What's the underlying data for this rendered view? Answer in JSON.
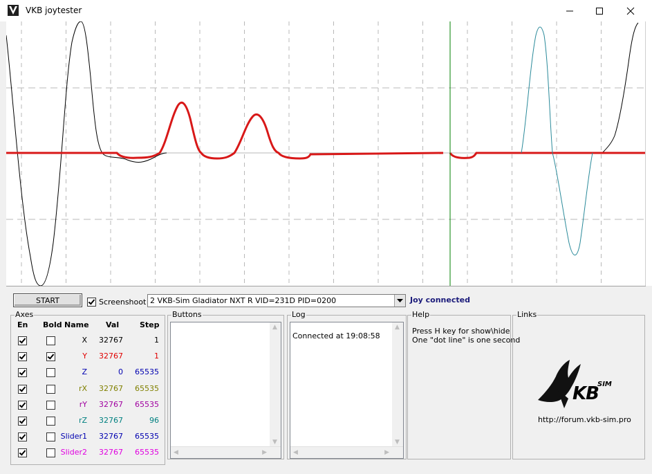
{
  "window": {
    "title": "VKB joytester"
  },
  "toolbar": {
    "start_label": "START",
    "screenshot_label": "Screenshoot",
    "screenshot_checked": true,
    "device_selected": "2  VKB-Sim Gladiator NXT R   VID=231D PID=0200",
    "status": "Joy connected"
  },
  "axes": {
    "group_title": "Axes",
    "headers": {
      "en": "En",
      "bold": "Bold",
      "name": "Name",
      "val": "Val",
      "step": "Step"
    },
    "rows": [
      {
        "name": "X",
        "val": "32767",
        "step": "1",
        "en": true,
        "bold": false,
        "color": "#000000"
      },
      {
        "name": "Y",
        "val": "32767",
        "step": "1",
        "en": true,
        "bold": true,
        "color": "#e00000"
      },
      {
        "name": "Z",
        "val": "0",
        "step": "65535",
        "en": true,
        "bold": false,
        "color": "#0000b0"
      },
      {
        "name": "rX",
        "val": "32767",
        "step": "65535",
        "en": true,
        "bold": false,
        "color": "#808000"
      },
      {
        "name": "rY",
        "val": "32767",
        "step": "65535",
        "en": true,
        "bold": false,
        "color": "#a000a0"
      },
      {
        "name": "rZ",
        "val": "32767",
        "step": "96",
        "en": true,
        "bold": false,
        "color": "#008080"
      },
      {
        "name": "Slider1",
        "val": "32767",
        "step": "65535",
        "en": true,
        "bold": false,
        "color": "#0000b0"
      },
      {
        "name": "Slider2",
        "val": "32767",
        "step": "65535",
        "en": true,
        "bold": false,
        "color": "#e000e0"
      }
    ]
  },
  "buttons_group": {
    "title": "Buttons"
  },
  "log_group": {
    "title": "Log",
    "lines": [
      "Connected at 19:08:58"
    ]
  },
  "help_group": {
    "title": "Help",
    "line1": "Press H key for show\\hide",
    "line2": "One \"dot line\" is one second"
  },
  "links_group": {
    "title": "Links",
    "logo_text": "KB",
    "logo_sup": "SIM",
    "url": "http://forum.vkb-sim.pro"
  },
  "colors": {
    "y_axis_trace": "#d81818",
    "x_axis_trace": "#000000",
    "rz_trace": "#2a8a9a",
    "cursor": "#008000"
  },
  "chart_data": {
    "type": "line",
    "series": [
      {
        "name": "X"
      },
      {
        "name": "Y"
      },
      {
        "name": "rZ"
      }
    ]
  }
}
